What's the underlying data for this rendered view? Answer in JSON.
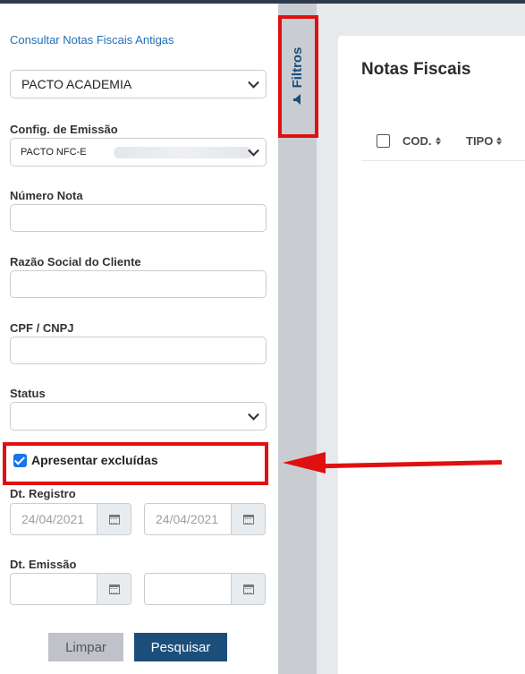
{
  "sidebar": {
    "link": "Consultar Notas Fiscais Antigas",
    "company": "PACTO ACADEMIA",
    "emission": {
      "label": "Config. de Emissão",
      "value": "PACTO NFC-E"
    },
    "numero_label": "Número Nota",
    "razao_label": "Razão Social do Cliente",
    "cpf_label": "CPF / CNPJ",
    "status_label": "Status",
    "show_deleted": {
      "label": "Apresentar excluídas",
      "checked": true
    },
    "registro": {
      "label": "Dt. Registro",
      "from": "24/04/2021",
      "to": "24/04/2021"
    },
    "emissao": {
      "label": "Dt. Emissão",
      "from": "",
      "to": ""
    },
    "clear_label": "Limpar",
    "search_label": "Pesquisar"
  },
  "toggle": {
    "label": "Filtros",
    "icon": "filter-icon"
  },
  "main": {
    "title": "Notas Fiscais",
    "columns": [
      "COD.",
      "TIPO"
    ]
  },
  "colors": {
    "primary": "#1b4e7a",
    "link": "#1f6fb5",
    "annotation": "#e01010",
    "checkbox": "#1a73e8"
  }
}
